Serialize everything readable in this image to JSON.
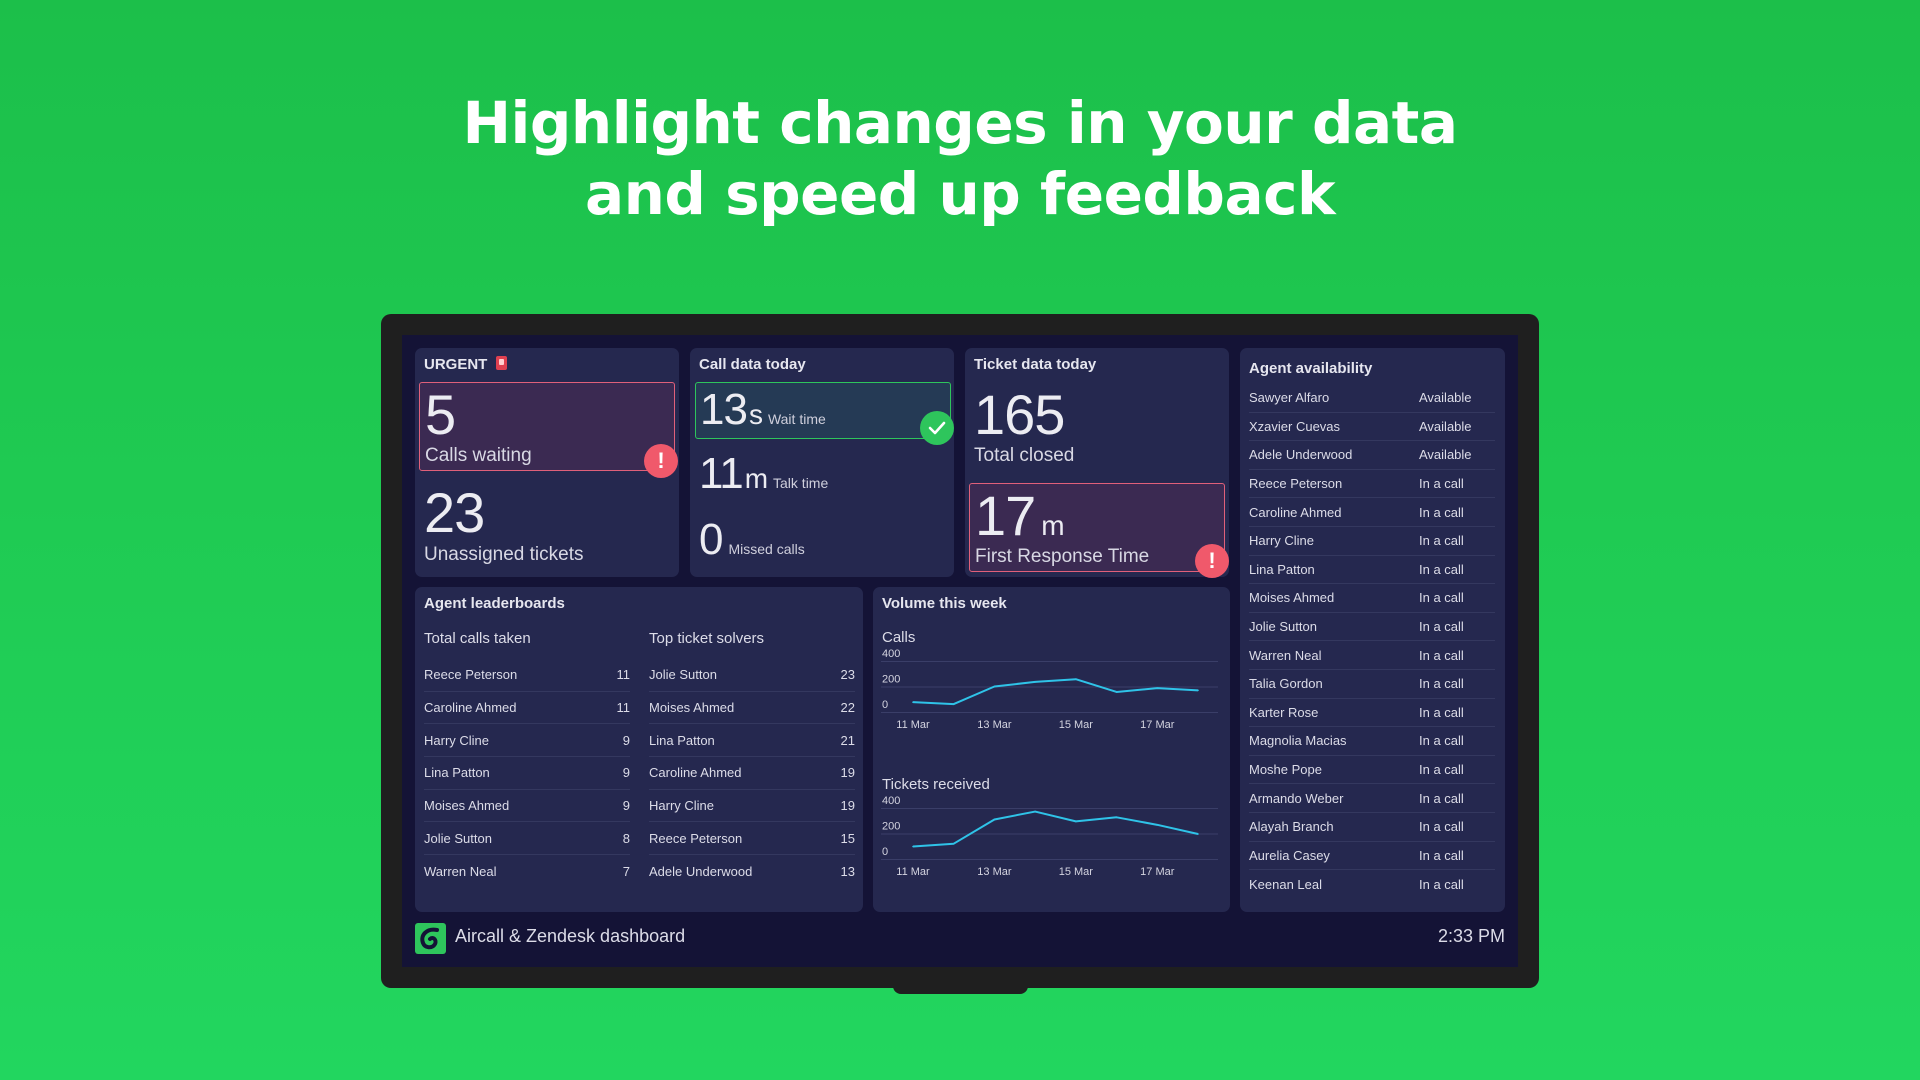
{
  "headline": {
    "line1": "Highlight changes in your data",
    "line2": "and speed up feedback"
  },
  "urgent": {
    "title": "URGENT",
    "title_icon": "police-siren-icon",
    "calls_waiting": {
      "value": "5",
      "label": "Calls waiting",
      "status": "alert"
    },
    "unassigned_tickets": {
      "value": "23",
      "label": "Unassigned tickets"
    }
  },
  "call_data": {
    "title": "Call data today",
    "wait_time": {
      "value": "13",
      "unit": "s",
      "label": "Wait time",
      "status": "ok"
    },
    "talk_time": {
      "value": "11",
      "unit": "m",
      "label": "Talk time"
    },
    "missed_calls": {
      "value": "0",
      "label": "Missed calls"
    }
  },
  "ticket_data": {
    "title": "Ticket data today",
    "total_closed": {
      "value": "165",
      "label": "Total closed"
    },
    "first_response": {
      "value": "17",
      "unit": "m",
      "label": "First Response Time",
      "status": "alert"
    }
  },
  "availability": {
    "title": "Agent availability",
    "agents": [
      {
        "name": "Sawyer Alfaro",
        "status": "Available"
      },
      {
        "name": "Xzavier Cuevas",
        "status": "Available"
      },
      {
        "name": "Adele Underwood",
        "status": "Available"
      },
      {
        "name": "Reece Peterson",
        "status": "In a call"
      },
      {
        "name": "Caroline Ahmed",
        "status": "In a call"
      },
      {
        "name": "Harry Cline",
        "status": "In a call"
      },
      {
        "name": "Lina Patton",
        "status": "In a call"
      },
      {
        "name": "Moises Ahmed",
        "status": "In a call"
      },
      {
        "name": "Jolie Sutton",
        "status": "In a call"
      },
      {
        "name": "Warren Neal",
        "status": "In a call"
      },
      {
        "name": "Talia Gordon",
        "status": "In a call"
      },
      {
        "name": "Karter Rose",
        "status": "In a call"
      },
      {
        "name": "Magnolia Macias",
        "status": "In a call"
      },
      {
        "name": "Moshe Pope",
        "status": "In a call"
      },
      {
        "name": "Armando Weber",
        "status": "In a call"
      },
      {
        "name": "Alayah Branch",
        "status": "In a call"
      },
      {
        "name": "Aurelia Casey",
        "status": "In a call"
      },
      {
        "name": "Keenan Leal",
        "status": "In a call"
      }
    ]
  },
  "leaderboards": {
    "title": "Agent leaderboards",
    "calls": {
      "heading": "Total calls taken",
      "rows": [
        {
          "name": "Reece Peterson",
          "value": "11"
        },
        {
          "name": "Caroline Ahmed",
          "value": "11"
        },
        {
          "name": "Harry Cline",
          "value": "9"
        },
        {
          "name": "Lina Patton",
          "value": "9"
        },
        {
          "name": "Moises Ahmed",
          "value": "9"
        },
        {
          "name": "Jolie Sutton",
          "value": "8"
        },
        {
          "name": "Warren Neal",
          "value": "7"
        }
      ]
    },
    "tickets": {
      "heading": "Top ticket solvers",
      "rows": [
        {
          "name": "Jolie Sutton",
          "value": "23"
        },
        {
          "name": "Moises Ahmed",
          "value": "22"
        },
        {
          "name": "Lina Patton",
          "value": "21"
        },
        {
          "name": "Caroline Ahmed",
          "value": "19"
        },
        {
          "name": "Harry Cline",
          "value": "19"
        },
        {
          "name": "Reece Peterson",
          "value": "15"
        },
        {
          "name": "Adele Underwood",
          "value": "13"
        }
      ]
    }
  },
  "volume": {
    "title": "Volume this week",
    "line_color": "#2fc3e8"
  },
  "chart_data": [
    {
      "type": "line",
      "title": "Calls",
      "x": [
        "11 Mar",
        "12 Mar",
        "13 Mar",
        "14 Mar",
        "15 Mar",
        "16 Mar",
        "17 Mar",
        "18 Mar"
      ],
      "x_tick_labels": [
        "11 Mar",
        "13 Mar",
        "15 Mar",
        "17 Mar"
      ],
      "series": [
        {
          "name": "Calls",
          "values": [
            77,
            62,
            200,
            236,
            257,
            157,
            187,
            170
          ]
        }
      ],
      "yticks": [
        0,
        200,
        400
      ],
      "ylim": [
        0,
        400
      ],
      "grid": true
    },
    {
      "type": "line",
      "title": "Tickets received",
      "x": [
        "11 Mar",
        "12 Mar",
        "13 Mar",
        "14 Mar",
        "15 Mar",
        "16 Mar",
        "17 Mar",
        "18 Mar"
      ],
      "x_tick_labels": [
        "11 Mar",
        "13 Mar",
        "15 Mar",
        "17 Mar"
      ],
      "series": [
        {
          "name": "Tickets received",
          "values": [
            98,
            120,
            310,
            372,
            295,
            327,
            268,
            196
          ]
        }
      ],
      "yticks": [
        0,
        200,
        400
      ],
      "ylim": [
        0,
        400
      ],
      "grid": true
    }
  ],
  "footer": {
    "logo_icon": "aircall-logo-icon",
    "title": "Aircall & Zendesk dashboard",
    "time": "2:33 PM"
  },
  "colors": {
    "alert": "#f0596b",
    "ok": "#2ec55c",
    "panel": "#25284f",
    "screen": "#141336"
  }
}
